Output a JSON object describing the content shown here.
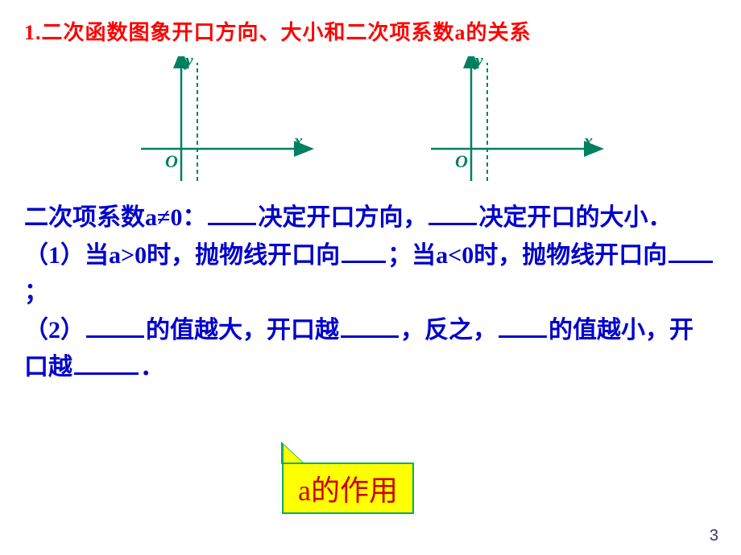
{
  "title": "1.二次函数图象开口方向、大小和二次项系数a的关系",
  "axes": {
    "y_label": "y",
    "x_label": "x",
    "origin_label": "O"
  },
  "body": {
    "line1_a": "二次项系数a≠0：",
    "line1_b": "决定开口方向，",
    "line1_c": "决定开口的大小．",
    "line2_a": "（1）当a>0时，抛物线开口向",
    "line2_b": "；当a<0时，抛物线开口向",
    "line2_c": "；",
    "line3_a": "（2）",
    "line3_b": "的值越大，开口越",
    "line3_c": "，反之，",
    "line3_d": "的值越小，开口越",
    "line3_e": "．"
  },
  "callout": "a的作用",
  "page_number": "3"
}
